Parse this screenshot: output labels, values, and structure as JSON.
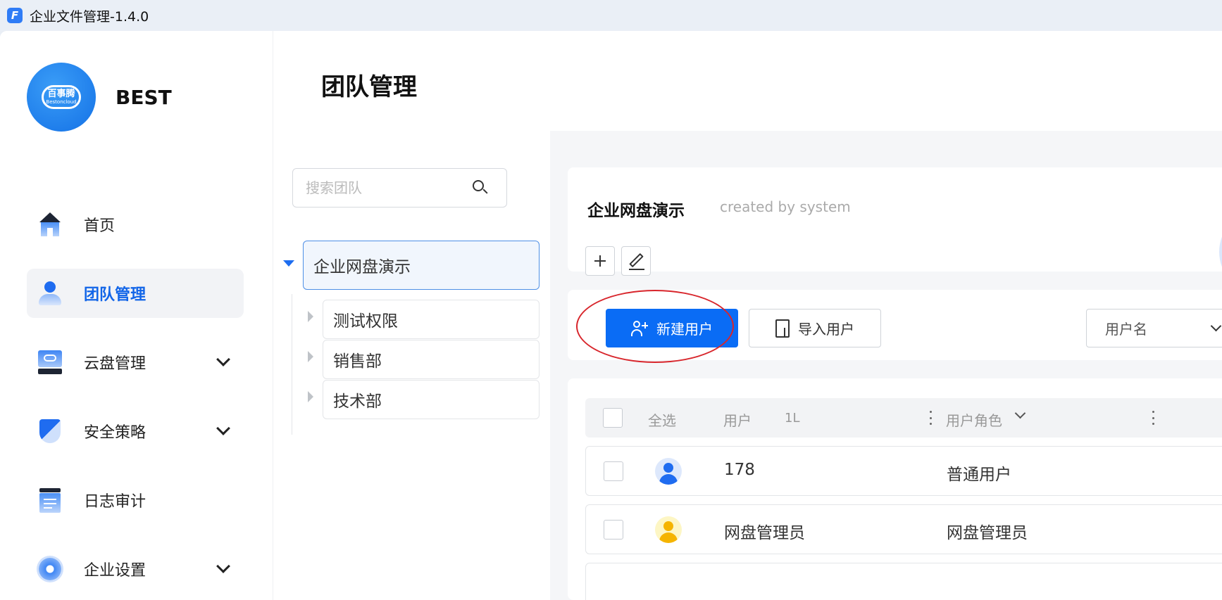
{
  "window": {
    "title": "企业文件管理-1.4.0",
    "app_icon": "F"
  },
  "sidebar": {
    "logo": {
      "cn": "百事腾",
      "en": "Bestoncloud"
    },
    "brand": "BEST",
    "items": [
      {
        "label": "首页",
        "icon": "home-icon",
        "active": false,
        "expandable": false
      },
      {
        "label": "团队管理",
        "icon": "team-icon",
        "active": true,
        "expandable": false
      },
      {
        "label": "云盘管理",
        "icon": "cloud-disk-icon",
        "active": false,
        "expandable": true
      },
      {
        "label": "安全策略",
        "icon": "shield-icon",
        "active": false,
        "expandable": true
      },
      {
        "label": "日志审计",
        "icon": "log-icon",
        "active": false,
        "expandable": false
      },
      {
        "label": "企业设置",
        "icon": "gear-icon",
        "active": false,
        "expandable": true
      }
    ]
  },
  "main": {
    "title": "团队管理"
  },
  "team_tree": {
    "search_placeholder": "搜索团队",
    "root": {
      "label": "企业网盘演示",
      "expanded": true
    },
    "children": [
      {
        "label": "测试权限"
      },
      {
        "label": "销售部"
      },
      {
        "label": "技术部"
      }
    ]
  },
  "team_detail": {
    "name": "企业网盘演示",
    "meta": "created by system"
  },
  "toolbar": {
    "new_user": "新建用户",
    "import_user": "导入用户",
    "filter_field": "用户名"
  },
  "table": {
    "headers": {
      "select_all": "全选",
      "user": "用户",
      "sort_icon": "1L",
      "role": "用户角色"
    },
    "rows": [
      {
        "user": "178",
        "role": "普通用户",
        "avatar": "blue"
      },
      {
        "user": "网盘管理员",
        "role": "网盘管理员",
        "avatar": "yellow"
      }
    ]
  },
  "colors": {
    "accent": "#0a6cf5",
    "annotation": "#d8262c",
    "active_nav": "#1265e8"
  }
}
